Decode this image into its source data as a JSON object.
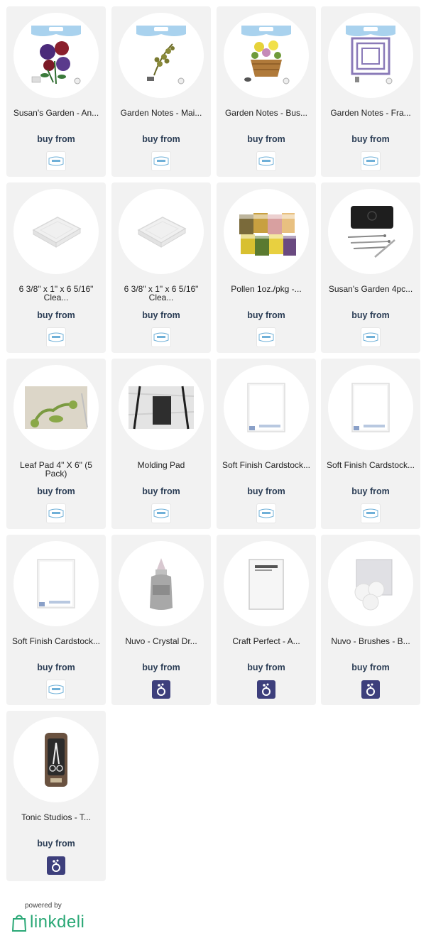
{
  "products": [
    {
      "title": "Susan's Garden - An...",
      "buy": "buy from",
      "image": "pansy-die-image",
      "retailer": "elizabeth-craft-logo"
    },
    {
      "title": "Garden Notes - Mai...",
      "buy": "buy from",
      "image": "fern-die-image",
      "retailer": "elizabeth-craft-logo"
    },
    {
      "title": "Garden Notes - Bus...",
      "buy": "buy from",
      "image": "basket-die-image",
      "retailer": "elizabeth-craft-logo"
    },
    {
      "title": "Garden Notes - Fra...",
      "buy": "buy from",
      "image": "frame-die-image",
      "retailer": "elizabeth-craft-logo"
    },
    {
      "title": "6 3/8\" x 1\" x 6 5/16\" Clea...",
      "buy": "buy from",
      "image": "clear-block-image",
      "retailer": "elizabeth-craft-logo"
    },
    {
      "title": "6 3/8\" x 1\" x 6 5/16\" Clea...",
      "buy": "buy from",
      "image": "clear-block-image",
      "retailer": "elizabeth-craft-logo"
    },
    {
      "title": "Pollen 1oz./pkg -...",
      "buy": "buy from",
      "image": "pollen-packs-image",
      "retailer": "elizabeth-craft-logo"
    },
    {
      "title": "Susan's Garden 4pc...",
      "buy": "buy from",
      "image": "tool-set-image",
      "retailer": "elizabeth-craft-logo"
    },
    {
      "title": "Leaf Pad 4\" X 6\" (5 Pack)",
      "buy": "buy from",
      "image": "leaf-pad-photo",
      "retailer": "elizabeth-craft-logo"
    },
    {
      "title": "Molding Pad",
      "buy": "buy from",
      "image": "molding-pad-photo",
      "retailer": "elizabeth-craft-logo"
    },
    {
      "title": "Soft Finish Cardstock...",
      "buy": "buy from",
      "image": "cardstock-pack-image",
      "retailer": "elizabeth-craft-logo"
    },
    {
      "title": "Soft Finish Cardstock...",
      "buy": "buy from",
      "image": "cardstock-pack-image",
      "retailer": "elizabeth-craft-logo"
    },
    {
      "title": "Soft Finish Cardstock...",
      "buy": "buy from",
      "image": "cardstock-pack-image",
      "retailer": "elizabeth-craft-logo"
    },
    {
      "title": "Nuvo - Crystal Dr...",
      "buy": "buy from",
      "image": "crystal-drops-bottle-image",
      "retailer": "scrapbook-store-logo"
    },
    {
      "title": "Craft Perfect - A...",
      "buy": "buy from",
      "image": "craft-perfect-pack-image",
      "retailer": "scrapbook-store-logo"
    },
    {
      "title": "Nuvo - Brushes - B...",
      "buy": "buy from",
      "image": "blending-brushes-image",
      "retailer": "scrapbook-store-logo"
    },
    {
      "title": "Tonic Studios - T...",
      "buy": "buy from",
      "image": "scissors-pack-image",
      "retailer": "scrapbook-store-logo"
    }
  ],
  "footer": {
    "powered_by": "powered by",
    "brand": "linkdeli"
  },
  "colors": {
    "card_bg": "#f2f2f2",
    "buy_text": "#2c3e56",
    "brand_green": "#2aa876",
    "retailer_badge": "#3d3f7c"
  }
}
